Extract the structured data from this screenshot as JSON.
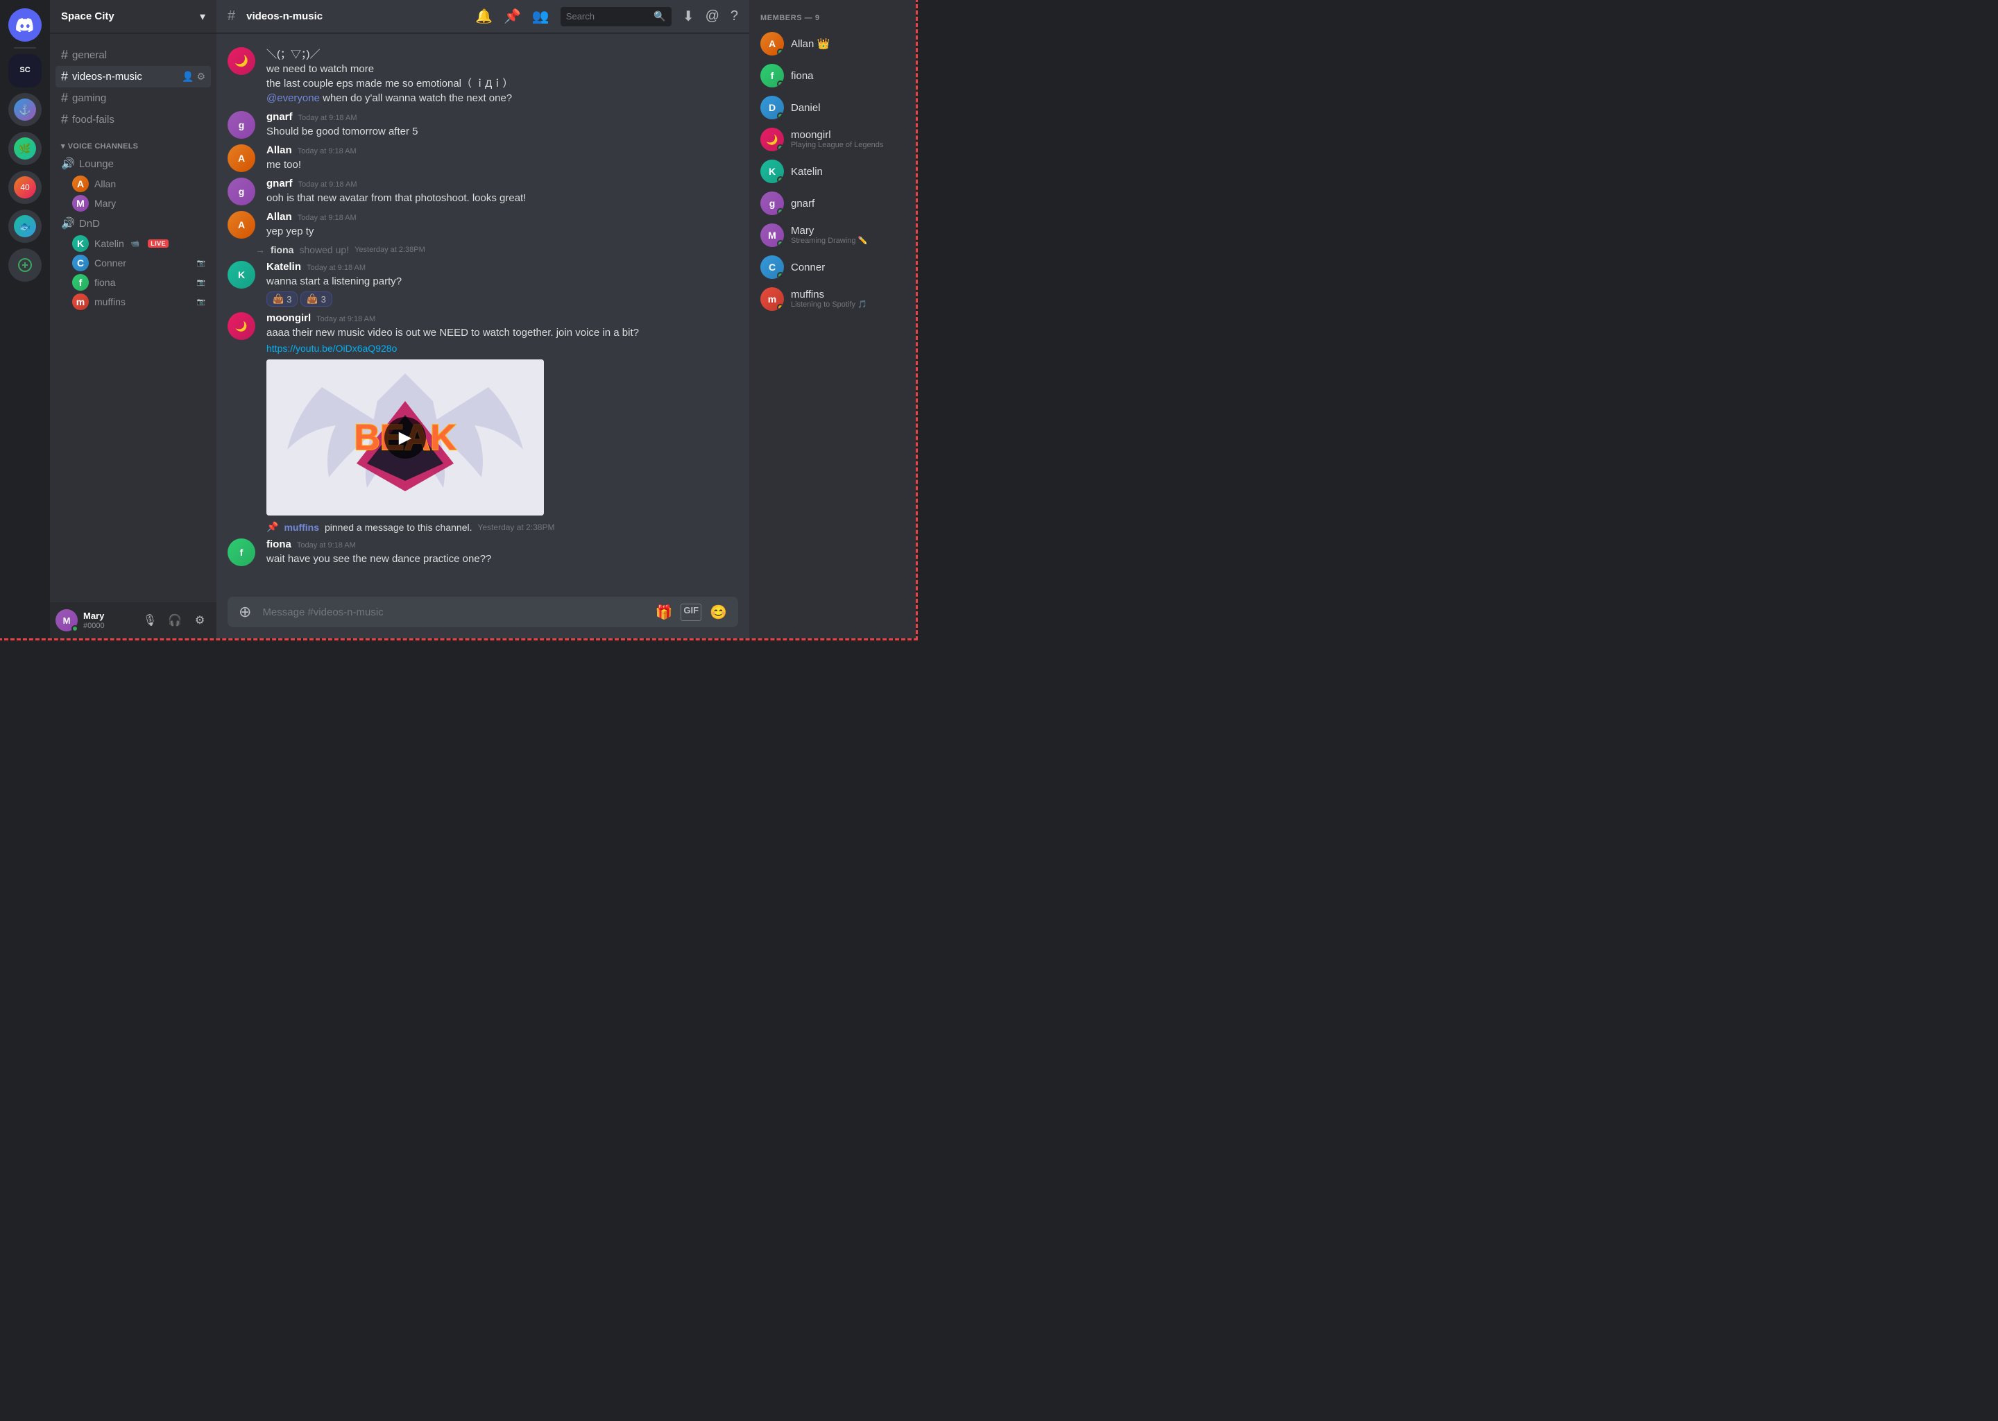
{
  "app": {
    "title": "Discord",
    "border_color": "#ed4245"
  },
  "server": {
    "name": "Space City",
    "dropdown_icon": "▾"
  },
  "sidebar": {
    "channels": [
      {
        "type": "text",
        "name": "general",
        "active": false
      },
      {
        "type": "text",
        "name": "videos-n-music",
        "active": true
      },
      {
        "type": "text",
        "name": "gaming",
        "active": false
      },
      {
        "type": "text",
        "name": "food-fails",
        "active": false
      }
    ],
    "voice_category": "VOICE CHANNELS",
    "voice_channels": [
      {
        "name": "Lounge",
        "members": [
          {
            "name": "Allan",
            "avatar_class": "av-orange"
          },
          {
            "name": "Mary",
            "avatar_class": "av-purple"
          }
        ]
      },
      {
        "name": "DnD",
        "members": [
          {
            "name": "Katelin",
            "avatar_class": "av-teal",
            "live": true
          },
          {
            "name": "Conner",
            "avatar_class": "av-blue"
          },
          {
            "name": "fiona",
            "avatar_class": "av-green"
          },
          {
            "name": "muffins",
            "avatar_class": "av-red"
          }
        ]
      }
    ]
  },
  "footer": {
    "username": "Mary",
    "discriminator": "#0000",
    "avatar_class": "av-purple"
  },
  "channel": {
    "name": "videos-n-music",
    "hash": "#"
  },
  "header_icons": {
    "bell": "🔔",
    "pin": "📌",
    "members": "👥",
    "search_placeholder": "Search",
    "download": "⬇",
    "at": "@",
    "help": "?"
  },
  "messages": [
    {
      "id": "m1",
      "type": "text",
      "author": "",
      "avatar_class": "av-pink",
      "timestamp": "",
      "lines": [
        "＼(；▽；)／",
        "we need to watch more",
        "the last couple eps made me so emotional（ ｉДｉ）",
        "@everyone when do y'all wanna watch the next one?"
      ],
      "mention": "@everyone"
    },
    {
      "id": "m2",
      "type": "text",
      "author": "gnarf",
      "avatar_class": "av-purple",
      "timestamp": "Today at 9:18 AM",
      "text": "Should be good tomorrow after 5"
    },
    {
      "id": "m3",
      "type": "text",
      "author": "Allan",
      "avatar_class": "av-orange",
      "timestamp": "Today at 9:18 AM",
      "text": "me too!"
    },
    {
      "id": "m4",
      "type": "text",
      "author": "gnarf",
      "avatar_class": "av-purple",
      "timestamp": "Today at 9:18 AM",
      "text": "ooh is that new avatar from that photoshoot. looks great!"
    },
    {
      "id": "m5",
      "type": "text",
      "author": "Allan",
      "avatar_class": "av-orange",
      "timestamp": "Today at 9:18 AM",
      "text": "yep yep ty"
    },
    {
      "id": "m6",
      "type": "system",
      "author": "fiona",
      "system_text": "showed up!",
      "timestamp": "Yesterday at 2:38PM"
    },
    {
      "id": "m7",
      "type": "text",
      "author": "Katelin",
      "avatar_class": "av-teal",
      "timestamp": "Today at 9:18 AM",
      "text": "wanna start a listening party?",
      "reactions": [
        {
          "emoji": "👜",
          "count": "3"
        },
        {
          "emoji": "👜",
          "count": "3"
        }
      ]
    },
    {
      "id": "m8",
      "type": "text",
      "author": "moongirl",
      "avatar_class": "av-pink",
      "timestamp": "Today at 9:18 AM",
      "text": "aaaa their new music video is out we NEED to watch together. join voice in a bit?",
      "link": "https://youtu.be/OiDx6aQ928o",
      "has_embed": true,
      "embed_title": "BEAK"
    },
    {
      "id": "m9",
      "type": "pinned",
      "pinner": "muffins",
      "action": "pinned a message to this channel.",
      "timestamp": "Yesterday at 2:38PM"
    },
    {
      "id": "m10",
      "type": "text",
      "author": "fiona",
      "avatar_class": "av-green",
      "timestamp": "Today at 9:18 AM",
      "text": "wait have you see the new dance practice one??"
    }
  ],
  "members": {
    "count_label": "MEMBERS — 9",
    "list": [
      {
        "name": "Allan",
        "crown": true,
        "avatar_class": "av-orange",
        "status": "online"
      },
      {
        "name": "fiona",
        "avatar_class": "av-green",
        "status": "online"
      },
      {
        "name": "Daniel",
        "avatar_class": "av-blue",
        "status": "online"
      },
      {
        "name": "moongirl",
        "avatar_class": "av-pink",
        "status": "online",
        "activity": "Playing League of Legends"
      },
      {
        "name": "Katelin",
        "avatar_class": "av-teal",
        "status": "online"
      },
      {
        "name": "gnarf",
        "avatar_class": "av-purple",
        "status": "online"
      },
      {
        "name": "Mary",
        "avatar_class": "av-purple",
        "status": "online",
        "activity": "Streaming Drawing ✏️"
      },
      {
        "name": "Conner",
        "avatar_class": "av-blue",
        "status": "online"
      },
      {
        "name": "muffins",
        "avatar_class": "av-red",
        "status": "idle",
        "activity": "Listening to Spotify 🎵"
      }
    ]
  },
  "input": {
    "placeholder": "Message #videos-n-music"
  },
  "icons": {
    "search": "🔍",
    "hash": "#",
    "speaker": "🔊",
    "microphone": "🎙",
    "headset": "🎧",
    "settings": "⚙",
    "add": "➕",
    "gift": "🎁",
    "gif_label": "GIF",
    "emoji": "😊",
    "pin_icon": "📌",
    "arrow_right": "→"
  }
}
